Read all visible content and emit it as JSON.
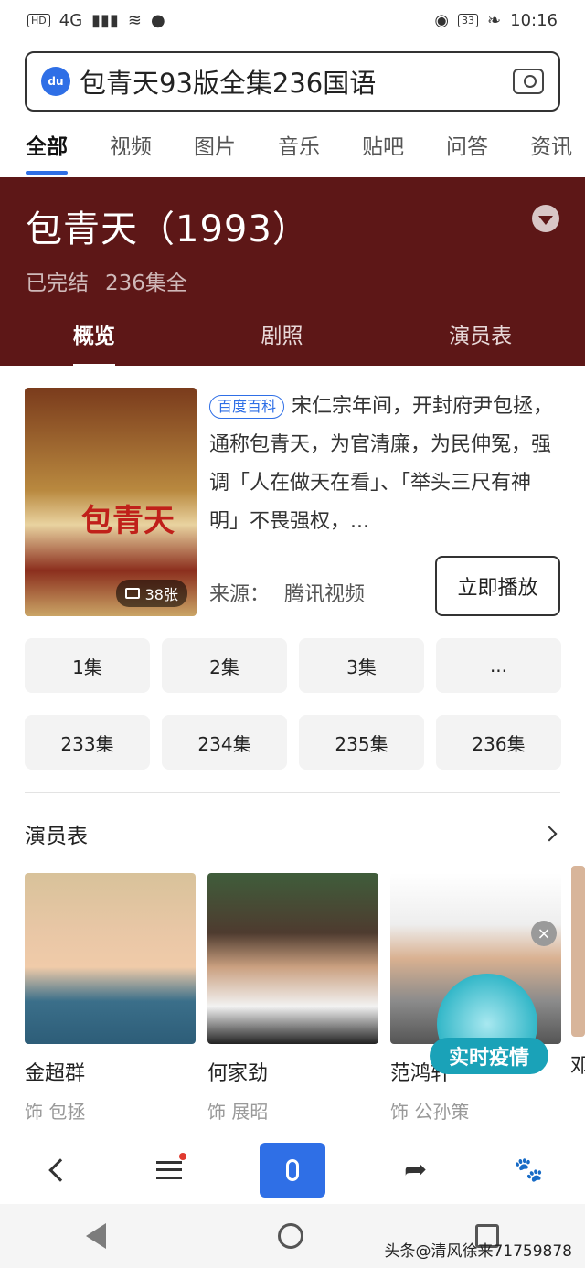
{
  "status": {
    "signal": "4G",
    "time": "10:16",
    "battery": "33"
  },
  "search": {
    "query": "包青天93版全集236国语"
  },
  "tabs": [
    {
      "label": "全部"
    },
    {
      "label": "视频"
    },
    {
      "label": "图片"
    },
    {
      "label": "音乐"
    },
    {
      "label": "贴吧"
    },
    {
      "label": "问答"
    },
    {
      "label": "资讯"
    }
  ],
  "hero": {
    "title": "包青天（1993）",
    "status": "已完结",
    "episodes": "236集全",
    "subtabs": [
      {
        "label": "概览"
      },
      {
        "label": "剧照"
      },
      {
        "label": "演员表"
      }
    ]
  },
  "info": {
    "poster_title": "包青天",
    "photo_count": "38张",
    "tag": "百度百科",
    "description": "宋仁宗年间，开封府尹包拯，通称包青天，为官清廉，为民伸冤，强调「人在做天在看」、「举头三尺有神明」不畏强权，...",
    "source_label": "来源：",
    "source": "腾讯视频",
    "play_label": "立即播放"
  },
  "episodes": [
    {
      "label": "1集"
    },
    {
      "label": "2集"
    },
    {
      "label": "3集"
    },
    {
      "label": "..."
    },
    {
      "label": "233集"
    },
    {
      "label": "234集"
    },
    {
      "label": "235集"
    },
    {
      "label": "236集"
    }
  ],
  "cast": {
    "title": "演员表",
    "members": [
      {
        "name": "金超群",
        "role": "饰 包拯"
      },
      {
        "name": "何家劲",
        "role": "饰 展昭"
      },
      {
        "name": "范鸿轩",
        "role": "饰 公孙策"
      }
    ],
    "next_partial": "邓"
  },
  "badge": {
    "label": "实时疫情"
  },
  "watermark": "头条@清风徐来71759878"
}
